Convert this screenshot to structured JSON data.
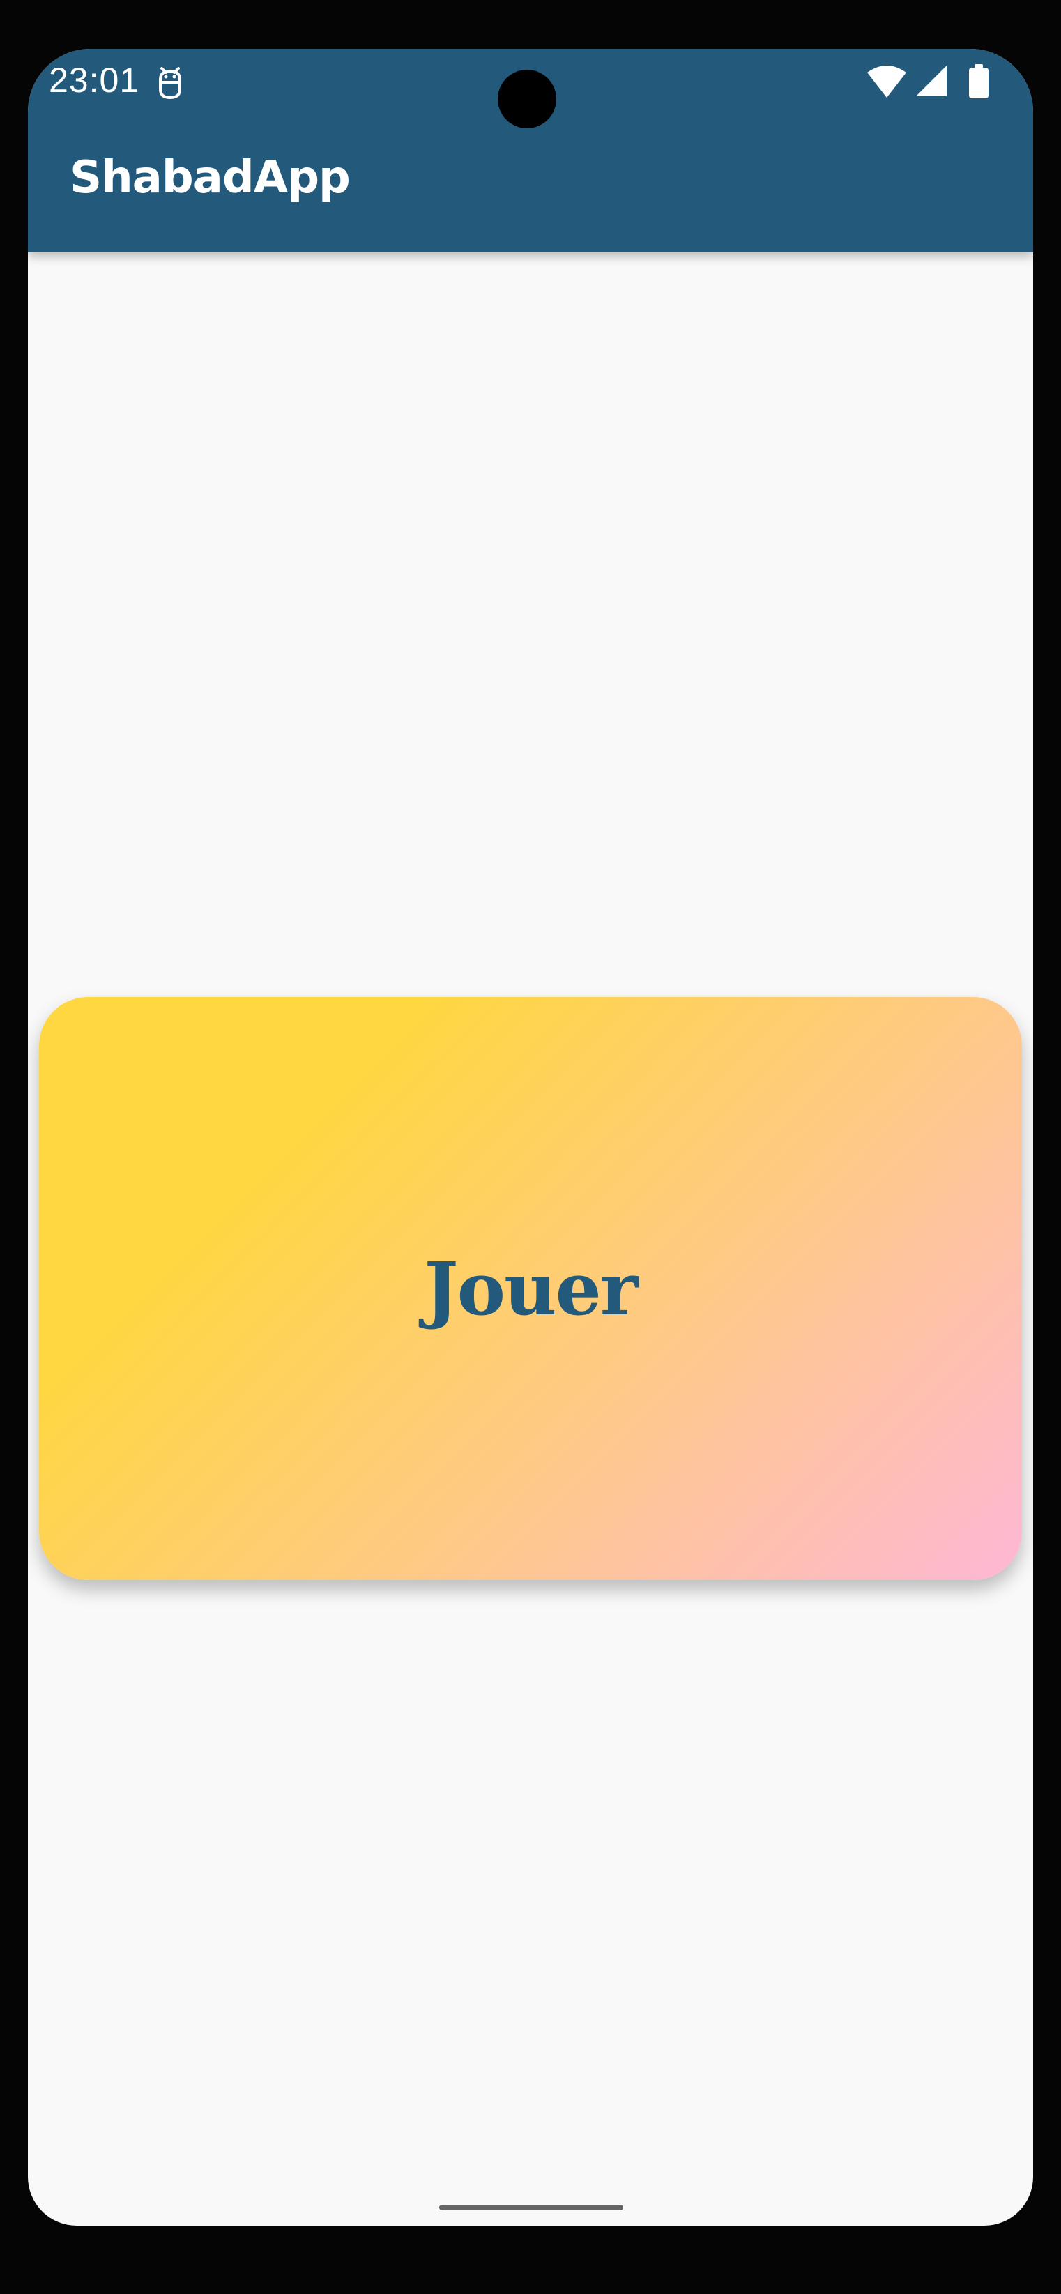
{
  "status_bar": {
    "time": "23:01",
    "notification_icon": "android-debug-icon",
    "wifi_icon": "wifi-icon",
    "signal_icon": "cellular-signal-icon",
    "battery_icon": "battery-icon"
  },
  "app_bar": {
    "title": "ShabadApp",
    "background_color": "#235a7c"
  },
  "main": {
    "play_button_label": "Jouer",
    "card_gradient": [
      "#fed741",
      "#fec988",
      "#feb7d5"
    ],
    "label_color": "#235a7c"
  }
}
